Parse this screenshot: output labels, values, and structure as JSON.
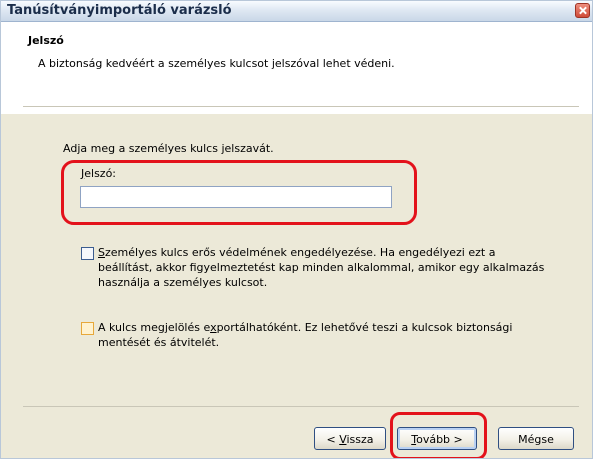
{
  "window": {
    "title": "Tanúsítványimportáló varázsló",
    "close_icon": "close-icon"
  },
  "header": {
    "title": "Jelszó",
    "description": "A biztonság kedvéért a személyes kulcsot jelszóval lehet védeni."
  },
  "content": {
    "prompt": "Adja meg a személyes kulcs jelszavát.",
    "password_label_first": "J",
    "password_label_rest": "elszó:",
    "password_value": ""
  },
  "options": {
    "strong_protection": {
      "checked": false,
      "line1_first": "S",
      "line1_rest": "zemélyes kulcs erős védelmének engedélyezése. Ha engedélyezi ezt a",
      "line2": "beállítást, akkor figyelmeztetést kap minden alkalommal, amikor egy alkalmazás",
      "line3": "használja a személyes kulcsot."
    },
    "exportable": {
      "checked": false,
      "line1_before": "A kulcs megjelölés e",
      "line1_u": "x",
      "line1_after": "portálhatóként. Ez lehetővé teszi a kulcsok biztonsági",
      "line2": "mentését és átvitelét."
    }
  },
  "buttons": {
    "back_before": "< ",
    "back_u": "V",
    "back_after": "issza",
    "next_u": "T",
    "next_after": "ovább >",
    "cancel": "Mégse"
  },
  "colors": {
    "annotation": "#e3121b",
    "dialog_background": "#ece9d8",
    "focus_checkbox": "#fff2cf"
  }
}
